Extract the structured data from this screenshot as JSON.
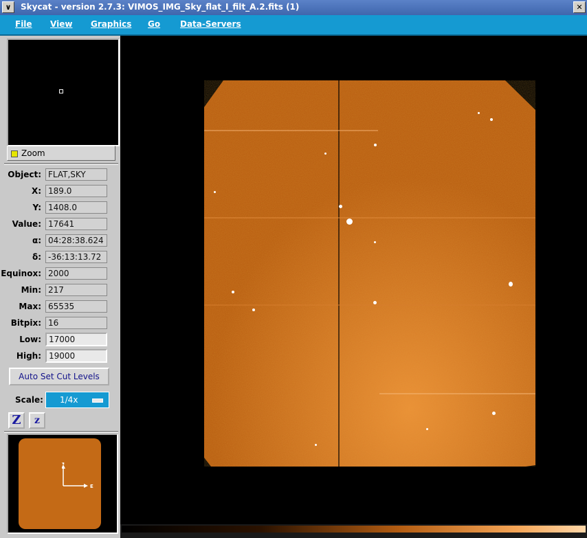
{
  "window": {
    "title": "Skycat - version 2.7.3: VIMOS_IMG_Sky_flat_I_filt_A.2.fits (1)"
  },
  "menubar": {
    "items": [
      "File",
      "View",
      "Graphics",
      "Go",
      "Data-Servers"
    ]
  },
  "panel": {
    "zoom_label": "Zoom",
    "rows": [
      {
        "label": "Object:",
        "value": "FLAT,SKY"
      },
      {
        "label": "X:",
        "value": "189.0"
      },
      {
        "label": "Y:",
        "value": "1408.0"
      },
      {
        "label": "Value:",
        "value": "17641"
      },
      {
        "label": "α:",
        "value": "04:28:38.624"
      },
      {
        "label": "δ:",
        "value": "-36:13:13.72"
      },
      {
        "label": "Equinox:",
        "value": "2000"
      },
      {
        "label": "Min:",
        "value": "217"
      },
      {
        "label": "Max:",
        "value": "65535"
      },
      {
        "label": "Bitpix:",
        "value": "16"
      },
      {
        "label": "Low:",
        "value": "17000"
      },
      {
        "label": "High:",
        "value": "19000"
      }
    ],
    "auto_cut_label": "Auto Set Cut Levels",
    "scale_label": "Scale:",
    "scale_value": "1/4x",
    "zoom_in_label": "Z",
    "zoom_out_label": "z",
    "compass": {
      "north": "N",
      "east": "E"
    }
  },
  "colors": {
    "accent": "#159ad2",
    "image": "#c46a16"
  }
}
